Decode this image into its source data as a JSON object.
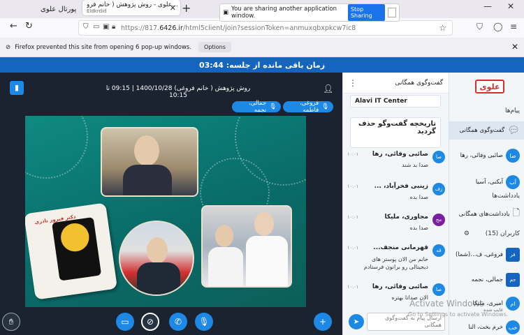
{
  "browser": {
    "tabs": [
      {
        "label": "پورتال علوی"
      },
      {
        "label": "علوی - روش پژوهش ( خانم فرو...",
        "sub": "Eldkrdid"
      }
    ],
    "share_bar": {
      "text": "You are sharing another application window.",
      "stop_label": "Stop Sharing"
    },
    "url": {
      "prefix": "https://817.",
      "host": "6426.ir",
      "path": "/html5client/join?sessionToken=anmuxqbxpkcw7ic8"
    },
    "popup": {
      "text": "Firefox prevented this site from opening 6 pop-up windows.",
      "options_label": "Options"
    }
  },
  "timer": {
    "text": "زمان باقی مانده از جلسه: 03:44"
  },
  "session": {
    "title": "روش پژوهش ( خانم فروغی) 1400/10/28 | 09:15 تا 10:15",
    "talkers": [
      "فروغی، فاطمه",
      "جمالی، نجمه"
    ]
  },
  "slide": {
    "book_label": "دکتر فیروز نادری"
  },
  "chat": {
    "header": "گفت‌وگوی همگانی",
    "system_1": "Alavi IT Center",
    "system_2": "تاریخچه گفت‌وگو حذف گردید",
    "messages": [
      {
        "initials": "صا",
        "name": "صائبی وفائی، رها",
        "time": "۱۰:۰۱",
        "text": "صدا بد شند",
        "color": "#1e88e5"
      },
      {
        "initials": "زف",
        "name": "زینبی فخرآباد، ...",
        "time": "۱۰:۰۱",
        "text": "صدا بده",
        "color": "#1e88e5"
      },
      {
        "initials": "مح",
        "name": "مجاوری، ملیکا",
        "time": "۱۰:۰۱",
        "text": "صدا بده",
        "color": "#7b1fa2"
      },
      {
        "initials": "قه",
        "name": "قهرمانی منجف...",
        "time": "۱۰:۰۱",
        "text": "خانم من الان پوستر های دیجیتالی رو برانون فرستادم",
        "color": "#1e88e5"
      },
      {
        "initials": "صا",
        "name": "صائبی وفائی، رها",
        "time": "۱۰:۰۱",
        "text": "الان صداتا بهتره",
        "color": "#1e88e5"
      }
    ],
    "input_placeholder": "ارسال پیام به گفت‌وگوی همگانی"
  },
  "sidebar": {
    "brand": "علوی",
    "messages_title": "پیام‌ها",
    "public_chat": "گفت‌وگوی همگانی",
    "private_chat": {
      "name": "صائبی وفائی، رها",
      "initials": "صا"
    },
    "private_chat_2": {
      "name": "آبکنی، آسیا",
      "initials": "آب"
    },
    "notes_title": "یادداشت‌ها",
    "shared_notes": "یادداشت‌های همگانی",
    "users_title": "کاربران (15)",
    "users": [
      {
        "name": "فروغی، ف...(شما)",
        "initials": "فر",
        "sub": ""
      },
      {
        "name": "جمالی، نجمه",
        "initials": "جم",
        "sub": ""
      },
      {
        "name": "امیری، ملیکا",
        "initials": "ام",
        "sub": "غایب شده"
      },
      {
        "name": "خرم بخت، النا",
        "initials": "خب",
        "sub": ""
      }
    ]
  },
  "watermark": {
    "title": "Activate Windows",
    "sub": "Go to Settings to activate Windows."
  }
}
